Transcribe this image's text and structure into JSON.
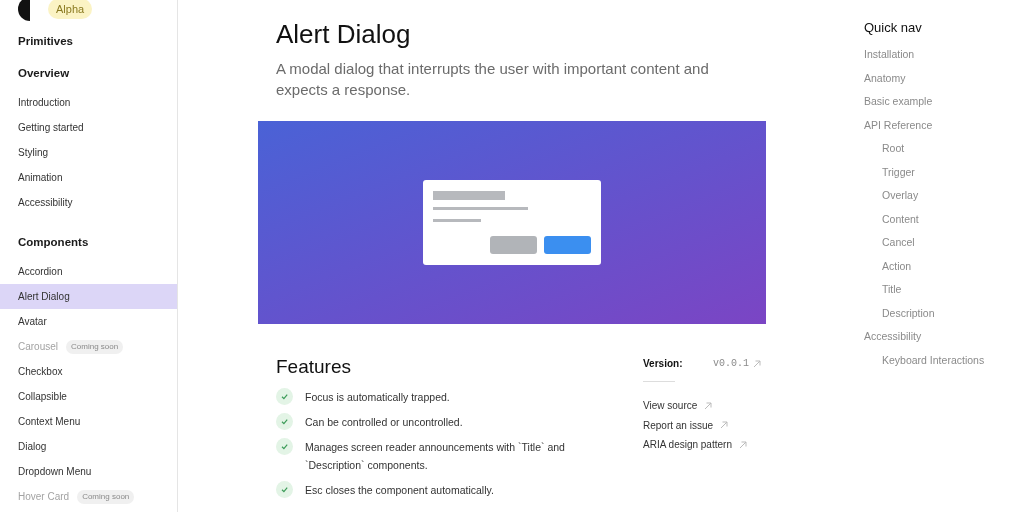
{
  "logo": {
    "badge": "Alpha"
  },
  "sidebar": {
    "sections": [
      {
        "title": "Primitives"
      },
      {
        "title": "Overview",
        "items": [
          {
            "label": "Introduction",
            "selected": false,
            "disabled": false
          },
          {
            "label": "Getting started",
            "selected": false,
            "disabled": false
          },
          {
            "label": "Styling",
            "selected": false,
            "disabled": false
          },
          {
            "label": "Animation",
            "selected": false,
            "disabled": false
          },
          {
            "label": "Accessibility",
            "selected": false,
            "disabled": false
          }
        ]
      },
      {
        "title": "Components",
        "items": [
          {
            "label": "Accordion",
            "selected": false,
            "disabled": false
          },
          {
            "label": "Alert Dialog",
            "selected": true,
            "disabled": false
          },
          {
            "label": "Avatar",
            "selected": false,
            "disabled": false
          },
          {
            "label": "Carousel",
            "selected": false,
            "disabled": true,
            "badge": "Coming soon"
          },
          {
            "label": "Checkbox",
            "selected": false,
            "disabled": false
          },
          {
            "label": "Collapsible",
            "selected": false,
            "disabled": false
          },
          {
            "label": "Context Menu",
            "selected": false,
            "disabled": false
          },
          {
            "label": "Dialog",
            "selected": false,
            "disabled": false
          },
          {
            "label": "Dropdown Menu",
            "selected": false,
            "disabled": false
          },
          {
            "label": "Hover Card",
            "selected": false,
            "disabled": true,
            "badge": "Coming soon"
          }
        ]
      }
    ]
  },
  "page": {
    "title": "Alert Dialog",
    "description": "A modal dialog that interrupts the user with important content and expects a response.",
    "features_title": "Features",
    "features": [
      "Focus is automatically trapped.",
      "Can be controlled or uncontrolled.",
      "Manages screen reader announcements with `Title` and `Description` components.",
      "Esc closes the component automatically."
    ],
    "version_label": "Version:",
    "version": "v0.0.1",
    "links": [
      "View source",
      "Report an issue",
      "ARIA design pattern"
    ]
  },
  "quick_nav": {
    "title": "Quick nav",
    "items": [
      {
        "label": "Installation"
      },
      {
        "label": "Anatomy"
      },
      {
        "label": "Basic example"
      },
      {
        "label": "API Reference",
        "children": [
          {
            "label": "Root"
          },
          {
            "label": "Trigger"
          },
          {
            "label": "Overlay"
          },
          {
            "label": "Content"
          },
          {
            "label": "Cancel"
          },
          {
            "label": "Action"
          },
          {
            "label": "Title"
          },
          {
            "label": "Description"
          }
        ]
      },
      {
        "label": "Accessibility",
        "children": [
          {
            "label": "Keyboard Interactions"
          }
        ]
      }
    ]
  }
}
